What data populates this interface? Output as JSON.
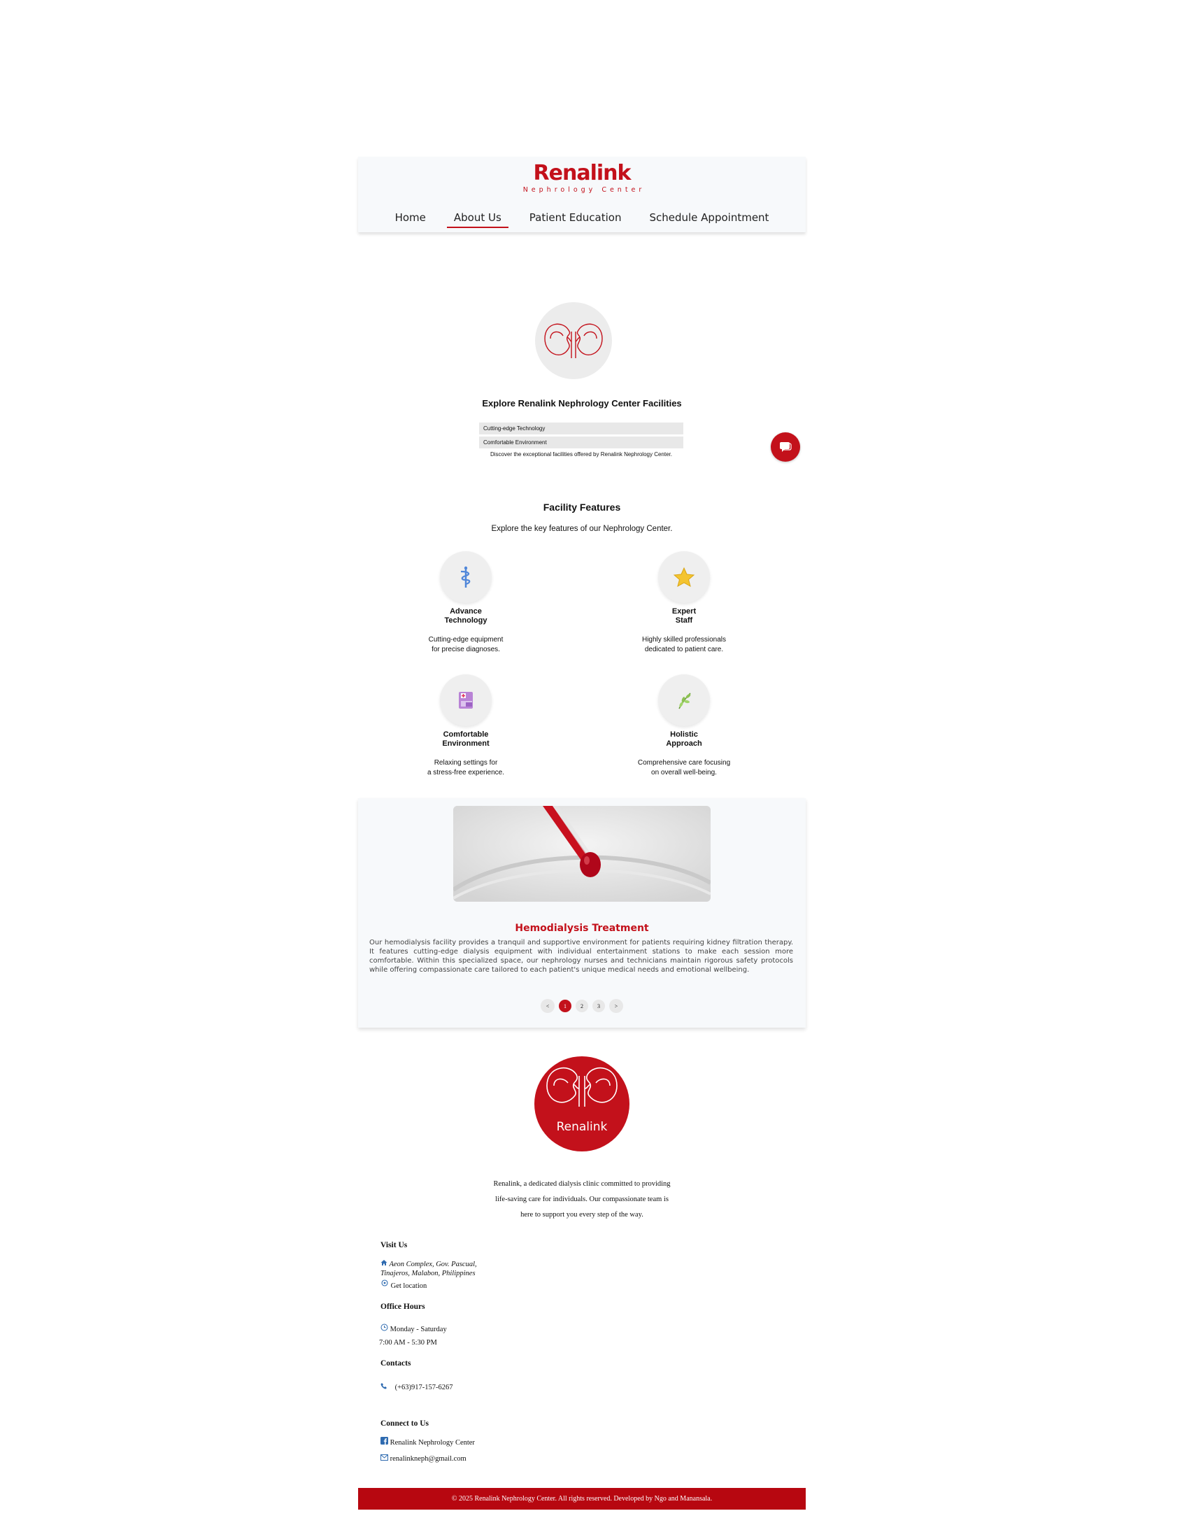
{
  "brand": {
    "name": "Renalink",
    "subtitle": "Nephrology Center"
  },
  "nav": {
    "items": [
      "Home",
      "About Us",
      "Patient Education",
      "Schedule Appointment"
    ],
    "active": "About Us"
  },
  "hero": {
    "title": "Explore Renalink Nephrology Center Facilities",
    "list": [
      "Cutting-edge Technology",
      "Comfortable Environment"
    ],
    "description": "Discover the exceptional facilities offered by Renalink Nephrology Center."
  },
  "features": {
    "title": "Facility Features",
    "subtitle": "Explore the key features of our Nephrology Center.",
    "items": [
      {
        "icon": "caduceus-icon",
        "title1": "Advance",
        "title2": "Technology",
        "desc1": "Cutting-edge equipment",
        "desc2": "for precise diagnoses."
      },
      {
        "icon": "star-icon",
        "title1": "Expert",
        "title2": "Staff",
        "desc1": "Highly skilled professionals",
        "desc2": "dedicated to patient care."
      },
      {
        "icon": "hospital-bed-icon",
        "title1": "Comfortable",
        "title2": "Environment",
        "desc1": "Relaxing settings for",
        "desc2": "a stress-free experience."
      },
      {
        "icon": "herb-icon",
        "title1": "Holistic",
        "title2": "Approach",
        "desc1": "Comprehensive care focusing",
        "desc2": "on overall well-being."
      }
    ]
  },
  "treatment": {
    "title": "Hemodialysis Treatment",
    "text": "Our hemodialysis facility provides a tranquil and supportive environment for patients requiring kidney filtration therapy. It features cutting-edge dialysis equipment with individual entertainment stations to make each session more comfortable. Within this specialized space, our nephrology nurses and technicians maintain rigorous safety protocols while offering compassionate care tailored to each patient's unique medical needs and emotional wellbeing.",
    "pager": {
      "prev": "<",
      "pages": [
        "1",
        "2",
        "3"
      ],
      "next": ">",
      "current": "1"
    }
  },
  "footer": {
    "logo_text": "Renalink",
    "about": [
      "Renalink, a dedicated dialysis clinic committed to providing",
      "life-saving care for individuals. Our compassionate team is",
      "here to support you every step of the way."
    ],
    "visit": {
      "heading": "Visit Us",
      "address1": "Aeon Complex, Gov. Pascual,",
      "address2": "Tinajeros, Malabon, Philippines",
      "location": "Get location"
    },
    "hours": {
      "heading": "Office Hours",
      "days": "Monday - Saturday",
      "time": "7:00 AM - 5:30 PM"
    },
    "contacts": {
      "heading": "Contacts",
      "phone": "(+63)917-157-6267"
    },
    "connect": {
      "heading": "Connect to Us",
      "facebook": "Renalink Nephrology Center",
      "email": "renalinkneph@gmail.com"
    },
    "copyright": "© 2025 Renalink Nephrology Center. All rights reserved. Developed by Ngo and Manansala."
  },
  "colors": {
    "brand": "#c3111b",
    "header_bg": "#f7f9fb",
    "footer_bar": "#b70710"
  }
}
